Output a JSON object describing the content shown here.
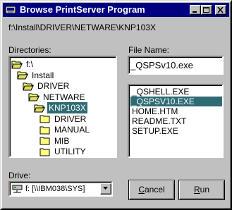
{
  "window": {
    "title": "Browse PrintServer Program"
  },
  "current_path": "f:\\Install\\DRIVER\\NETWARE\\KNP103X",
  "directories": {
    "label": "Directories:",
    "items": [
      {
        "name": "f:\\",
        "level": 0,
        "state": "open"
      },
      {
        "name": "Install",
        "level": 1,
        "state": "open"
      },
      {
        "name": "DRIVER",
        "level": 2,
        "state": "open"
      },
      {
        "name": "NETWARE",
        "level": 3,
        "state": "open"
      },
      {
        "name": "KNP103X",
        "level": 4,
        "state": "open",
        "selected": true
      },
      {
        "name": "DRIVER",
        "level": 5,
        "state": "closed"
      },
      {
        "name": "MANUAL",
        "level": 5,
        "state": "closed"
      },
      {
        "name": "MIB",
        "level": 5,
        "state": "closed"
      },
      {
        "name": "UTILITY",
        "level": 5,
        "state": "closed"
      }
    ]
  },
  "file_name": {
    "label": "File Name:",
    "value": "_QSPSv10.exe"
  },
  "files": {
    "items": [
      "_QSHELL.EXE",
      "_QSPSV10.EXE",
      "HOME.HTM",
      "README.TXT",
      "SETUP.EXE"
    ],
    "selected_index": 1
  },
  "drive": {
    "label": "Drive:",
    "value": "f: [\\\\IBM038\\SYS]"
  },
  "buttons": {
    "cancel_label": "Cancel",
    "run_label": "Run"
  },
  "colors": {
    "titlebar": "#000080",
    "selection": "#2e6b73",
    "face": "#c0c0c0",
    "folder": "#ffff80"
  }
}
